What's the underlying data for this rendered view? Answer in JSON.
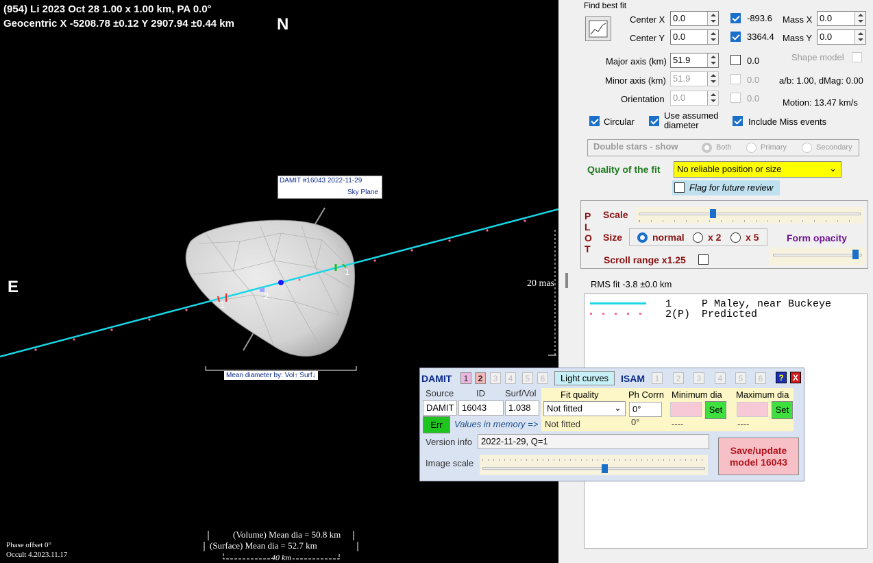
{
  "plot": {
    "header_line1": "(954) Li  2023 Oct 28   1.00 x 1.00 km, PA 0.0°",
    "header_line2": "Geocentric  X  -5208.78 ±0.12  Y 2907.94 ±0.44 km",
    "north_label": "N",
    "east_label": "E",
    "damit_tag_line1": "DAMIT #16043 2022-11-29",
    "damit_tag_line2": "Sky Plane",
    "chord1_label_a": "1",
    "chord1_label_b": "1",
    "chord2_label": "2",
    "scale_mas": "20 mas",
    "mean_diameter_caption": "Mean diameter by: Vol↑ Surf↓",
    "vol_mean_dia": "(Volume) Mean dia = 50.8 km",
    "surf_mean_dia": "(Surface) Mean dia = 52.7 km",
    "km_scale": "40 km",
    "phase_offset": "Phase offset 0°",
    "version": "Occult 4.2023.11.17"
  },
  "fit": {
    "title": "Find best fit",
    "center_x_label": "Center X",
    "center_x_value": "0.0",
    "center_x_result": "-893.6",
    "center_y_label": "Center Y",
    "center_y_value": "0.0",
    "center_y_result": "3364.4",
    "mass_x_label": "Mass X",
    "mass_x_value": "0.0",
    "mass_y_label": "Mass Y",
    "mass_y_value": "0.0",
    "major_label": "Major axis (km)",
    "major_value": "51.9",
    "major_result": "0.0",
    "minor_label": "Minor axis (km)",
    "minor_value": "51.9",
    "minor_result": "0.0",
    "orient_label": "Orientation",
    "orient_value": "0.0",
    "orient_result": "0.0",
    "shape_model_label": "Shape model",
    "ab_dmag": "a/b: 1.00, dMag: 0.00",
    "motion": "Motion: 13.47 km/s",
    "circular_label": "Circular",
    "assumed_label": "Use assumed diameter",
    "include_miss_label": "Include Miss events"
  },
  "double_stars": {
    "label": "Double stars - show",
    "opt_both": "Both",
    "opt_primary": "Primary",
    "opt_secondary": "Secondary"
  },
  "quality": {
    "label": "Quality of the fit",
    "value": "No reliable position or size",
    "flag_label": "Flag for future review",
    "highlight_color": "#ffff00"
  },
  "plotbox": {
    "side_label": [
      "P",
      "L",
      "O",
      "T"
    ],
    "scale_label": "Scale",
    "scale_level": 0.33,
    "size_label": "Size",
    "size_normal": "normal",
    "size_x2": "x 2",
    "size_x5": "x 5",
    "form_opacity_label": "Form opacity",
    "opacity_level": 0.96,
    "scroll_label": "Scroll range x1.25"
  },
  "rms": "RMS fit -3.8 ±0.0 km",
  "legend": [
    {
      "num": "1",
      "name": "P Maley, near Buckeye",
      "color": "#19d6e6",
      "style": "solid"
    },
    {
      "num": "2(P)",
      "name": "Predicted",
      "color": "#ff6699",
      "style": "dots"
    }
  ],
  "damit": {
    "label": "DAMIT",
    "nums": [
      "1",
      "2",
      "3",
      "4",
      "5",
      "6"
    ],
    "light_curves": "Light curves",
    "isam_label": "ISAM",
    "isam_nums": [
      "1",
      "2",
      "3",
      "4",
      "5",
      "6"
    ],
    "help": "?",
    "close": "X",
    "source_header": "Source",
    "id_header": "ID",
    "surfvol_header": "Surf/Vol",
    "source_value": "DAMIT",
    "id_value": "16043",
    "surfvol_value": "1.038",
    "fit_quality_header": "Fit quality",
    "fit_quality_value": "Not fitted",
    "fit_quality_mem": "Not fitted",
    "phcorr_header": "Ph Corrn",
    "phcorr_value": "0°",
    "phcorr_mem": "0°",
    "min_dia_header": "Minimum dia",
    "max_dia_header": "Maximum dia",
    "set_label": "Set",
    "min_dia_mem": "----",
    "max_dia_mem": "----",
    "err_label": "Err",
    "values_in_memory": "Values in memory =>",
    "version_info_label": "Version info",
    "version_info_value": "2022-11-29, Q=1",
    "image_scale_label": "Image scale",
    "image_scale_level": 0.55,
    "save_label": "Save/update model 16043"
  }
}
